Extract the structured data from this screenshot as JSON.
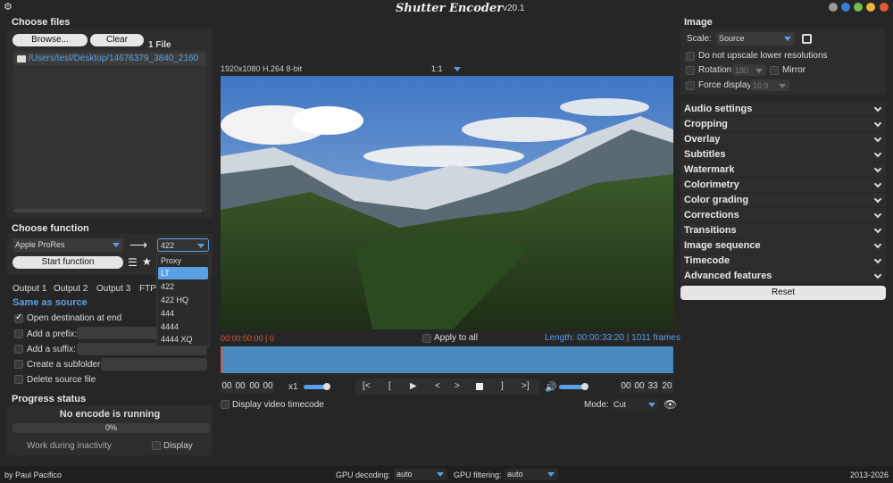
{
  "app": {
    "title": "Shutter Encoder",
    "version": "v20.1",
    "author": "by Paul Pacifico",
    "years": "2013-2026"
  },
  "colors": {
    "accent": "#5aa0e6",
    "background": "#262626",
    "panel": "#2d2d2d",
    "timecode_red": "#e0553a",
    "waveform": "#4a88c0"
  },
  "files": {
    "title": "Choose files",
    "browse": "Browse...",
    "clear": "Clear",
    "count": "1 File",
    "items": [
      "/Users/test/Desktop/14676379_3840_2160"
    ]
  },
  "function": {
    "title": "Choose function",
    "selected": "Apple ProRes",
    "profile": "422",
    "start": "Start function",
    "dropdown": [
      "Proxy",
      "LT",
      "422",
      "422 HQ",
      "444",
      "4444",
      "4444 XQ"
    ],
    "highlighted": "LT"
  },
  "output": {
    "tabs": [
      "Output 1",
      "Output 2",
      "Output 3",
      "FTP"
    ],
    "destination": "Same as source",
    "open_dest": "Open destination at end",
    "prefix": "Add a prefix:",
    "suffix": "Add a suffix:",
    "subfolder": "Create a subfolder:",
    "delete_source": "Delete source file"
  },
  "progress": {
    "title": "Progress status",
    "status": "No encode is running",
    "percent": "0%",
    "percent_value": 0,
    "inactivity": "Work during inactivity",
    "display": "Display"
  },
  "player": {
    "info": "1920x1080 H.264 8-bit",
    "zoom": "1:1",
    "timecode_in": "00:00:00:00",
    "frame_in": "0",
    "apply_all": "Apply to all",
    "length": "Length: 00:00:33:20",
    "frames": "1011 frames",
    "tc_start": [
      "00",
      "00",
      "00",
      "00"
    ],
    "tc_end": [
      "00",
      "00",
      "33",
      "20"
    ],
    "speed": "x1",
    "controls": [
      "[<",
      "[",
      "play",
      "<",
      ">",
      "stop",
      "]",
      ">]"
    ],
    "display_timecode": "Display video timecode",
    "mode_label": "Mode:",
    "mode": "Cut"
  },
  "image": {
    "title": "Image",
    "scale_label": "Scale:",
    "scale": "Source",
    "no_upscale": "Do not upscale lower resolutions",
    "rotation": "Rotation:",
    "rotation_value": "180",
    "mirror": "Mirror",
    "force_display": "Force display:",
    "force_display_value": "16:9"
  },
  "sections": [
    "Audio settings",
    "Cropping",
    "Overlay",
    "Subtitles",
    "Watermark",
    "Colorimetry",
    "Color grading",
    "Corrections",
    "Transitions",
    "Image sequence",
    "Timecode",
    "Advanced features"
  ],
  "reset": "Reset",
  "bottom": {
    "gpu_decoding": "GPU decoding:",
    "gpu_decoding_value": "auto",
    "gpu_filtering": "GPU filtering:",
    "gpu_filtering_value": "auto"
  }
}
